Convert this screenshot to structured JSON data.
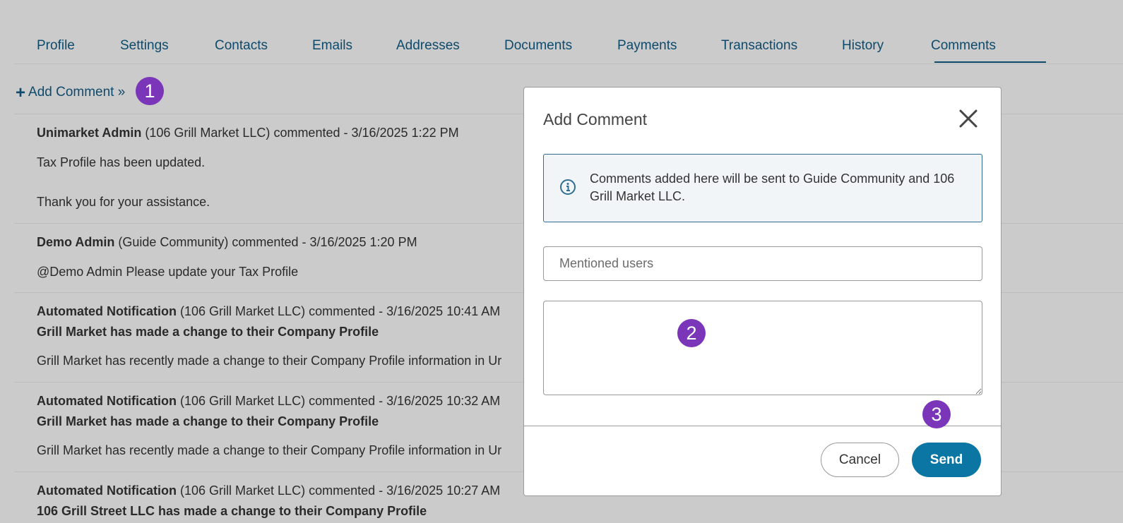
{
  "tabs": [
    "Profile",
    "Settings",
    "Contacts",
    "Emails",
    "Addresses",
    "Documents",
    "Payments",
    "Transactions",
    "History",
    "Comments"
  ],
  "active_tab": "Comments",
  "add_comment_label": "Add Comment »",
  "markers": [
    "1",
    "2",
    "3"
  ],
  "comments": [
    {
      "author": "Unimarket Admin",
      "org": "(106 Grill Market LLC)",
      "meta": "commented - 3/16/2025 1:22 PM",
      "line1": "Tax Profile has been updated.",
      "line2": "Thank you for your assistance."
    },
    {
      "author": "Demo Admin",
      "org": "(Guide Community)",
      "meta": "commented - 3/16/2025 1:20 PM",
      "line1": "@Demo Admin Please update your Tax Profile"
    },
    {
      "author": "Automated Notification",
      "org": "(106 Grill Market LLC)",
      "meta": "commented - 3/16/2025 10:41 AM",
      "subject": "Grill Market has made a change to their Company Profile",
      "body": "Grill Market has recently made a change to their Company Profile information in Ur"
    },
    {
      "author": "Automated Notification",
      "org": "(106 Grill Market LLC)",
      "meta": "commented - 3/16/2025 10:32 AM",
      "subject": "Grill Market has made a change to their Company Profile",
      "body": "Grill Market has recently made a change to their Company Profile information in Ur"
    },
    {
      "author": "Automated Notification",
      "org": "(106 Grill Market LLC)",
      "meta": "commented - 3/16/2025 10:27 AM",
      "subject": "106 Grill Street LLC has made a change to their Company Profile"
    }
  ],
  "modal": {
    "title": "Add Comment",
    "info": "Comments added here will be sent to Guide Community and 106 Grill Market LLC.",
    "mention_placeholder": "Mentioned users",
    "cancel_label": "Cancel",
    "send_label": "Send"
  },
  "icons": {
    "close": "close-icon",
    "info": "info-icon",
    "plus": "plus-icon"
  }
}
